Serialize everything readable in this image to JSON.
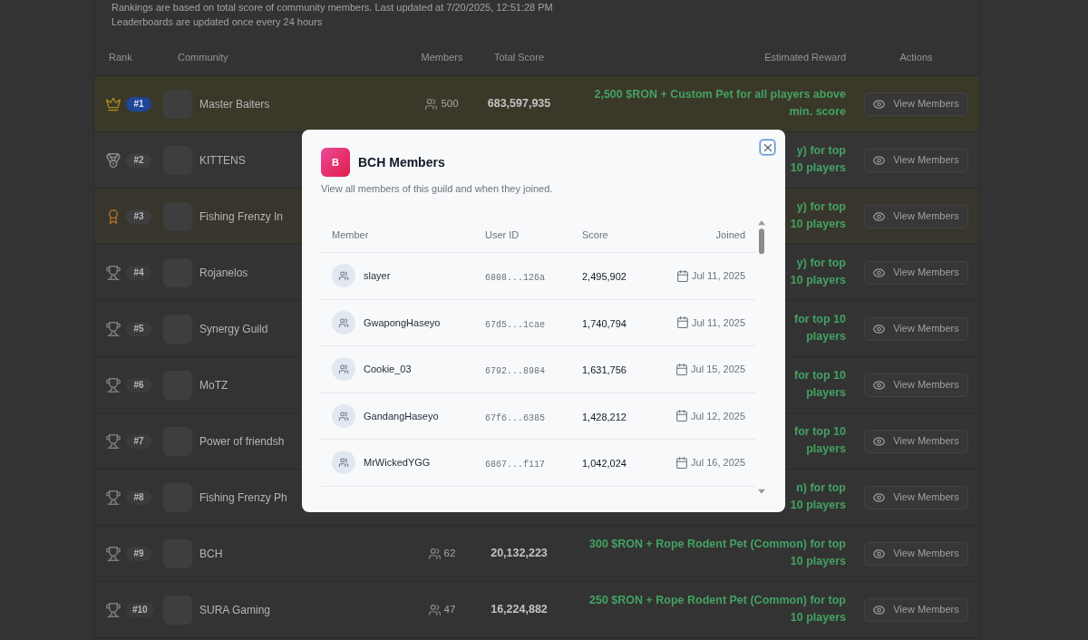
{
  "notes": [
    "Rankings are based on total score of community members. Last updated at 7/20/2025, 12:51:28 PM",
    "Leaderboards are updated once every 24 hours"
  ],
  "leaderboard": {
    "columns": [
      "Rank",
      "Community",
      "Members",
      "Total Score",
      "Estimated Reward",
      "Actions"
    ],
    "rows": [
      {
        "kind": "gold",
        "rank": "#1",
        "community": "Master Baiters",
        "members": "500",
        "total_score": "683,597,935",
        "reward": [
          "2,500 $RON + Custom Pet for all players above",
          "min. score"
        ],
        "action": "View Members"
      },
      {
        "kind": "silver",
        "rank": "#2",
        "community": "KITTENS",
        "reward": [
          "y) for top",
          "10 players"
        ],
        "action": "View Members"
      },
      {
        "kind": "bronze",
        "rank": "#3",
        "community": "Fishing Frenzy In",
        "reward": [
          "y) for top",
          "10 players"
        ],
        "action": "View Members"
      },
      {
        "kind": "standard",
        "rank": "#4",
        "community": "Rojanelos",
        "reward": [
          "y) for top",
          "10 players"
        ],
        "action": "View Members"
      },
      {
        "kind": "standard",
        "rank": "#5",
        "community": "Synergy Guild",
        "reward": [
          "for top 10",
          "players"
        ],
        "action": "View Members"
      },
      {
        "kind": "standard",
        "rank": "#6",
        "community": "MoTZ",
        "reward": [
          "for top 10",
          "players"
        ],
        "action": "View Members"
      },
      {
        "kind": "standard",
        "rank": "#7",
        "community": "Power of friendsh",
        "reward": [
          "for top 10",
          "players"
        ],
        "action": "View Members"
      },
      {
        "kind": "standard",
        "rank": "#8",
        "community": "Fishing Frenzy Ph",
        "reward": [
          "n) for top",
          "10 players"
        ],
        "action": "View Members"
      },
      {
        "kind": "standard",
        "rank": "#9",
        "community": "BCH",
        "members": "62",
        "total_score": "20,132,223",
        "reward": [
          "300 $RON + Rope Rodent Pet (Common) for top",
          "10 players"
        ],
        "action": "View Members"
      },
      {
        "kind": "standard",
        "rank": "#10",
        "community": "SURA Gaming",
        "members": "47",
        "total_score": "16,224,882",
        "reward": [
          "250 $RON + Rope Rodent Pet (Common) for top",
          "10 players"
        ],
        "action": "View Members"
      }
    ]
  },
  "modal": {
    "avatar_letter": "B",
    "title": "BCH Members",
    "subtitle": "View all members of this guild and when they joined.",
    "close_button": {
      "focused": true
    },
    "table": {
      "columns": [
        "Member",
        "User ID",
        "Score",
        "Joined"
      ],
      "rows": [
        {
          "member": "slayer",
          "user_id": "6808...126a",
          "score": "2,495,902",
          "joined": "Jul 11, 2025"
        },
        {
          "member": "GwapongHaseyo",
          "user_id": "67d5...1cae",
          "score": "1,740,794",
          "joined": "Jul 11, 2025"
        },
        {
          "member": "Cookie_03",
          "user_id": "6792...8984",
          "score": "1,631,756",
          "joined": "Jul 15, 2025"
        },
        {
          "member": "GandangHaseyo",
          "user_id": "67f6...6385",
          "score": "1,428,212",
          "joined": "Jul 12, 2025"
        },
        {
          "member": "MrWickedYGG",
          "user_id": "6867...f117",
          "score": "1,042,024",
          "joined": "Jul 16, 2025"
        }
      ]
    }
  }
}
